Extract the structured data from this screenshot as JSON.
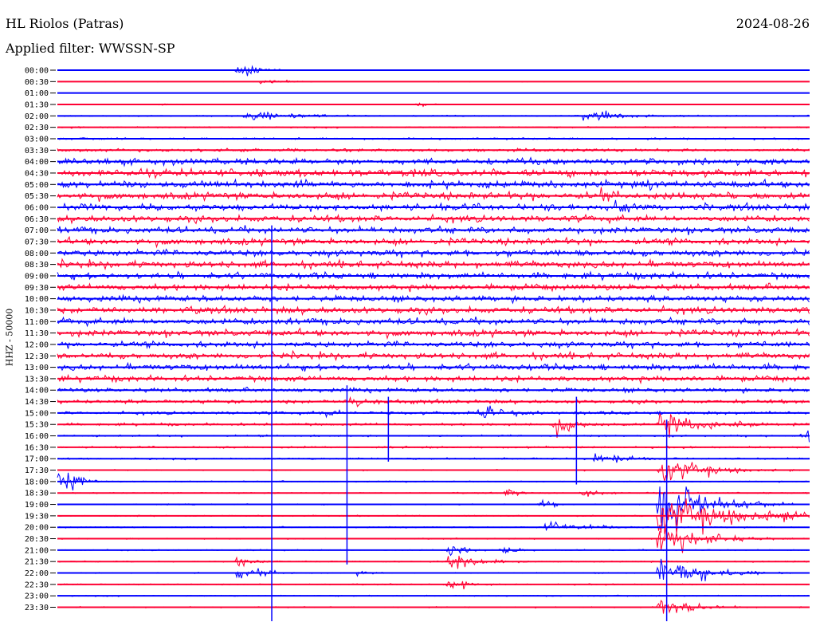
{
  "header": {
    "station": "HL Riolos (Patras)",
    "date": "2024-08-26",
    "filter": "Applied filter: WWSSN-SP"
  },
  "chart_data": {
    "type": "line",
    "title": "HL Riolos (Patras)",
    "subtitle": "Applied filter: WWSSN-SP",
    "date": "2024-08-26",
    "ylabel": "HHZ - 50000",
    "row_labels": [
      "00:00",
      "00:30",
      "01:00",
      "01:30",
      "02:00",
      "02:30",
      "03:00",
      "03:30",
      "04:00",
      "04:30",
      "05:00",
      "05:30",
      "06:00",
      "06:30",
      "07:00",
      "07:30",
      "08:00",
      "08:30",
      "09:00",
      "09:30",
      "10:00",
      "10:30",
      "11:00",
      "11:30",
      "12:00",
      "12:30",
      "13:00",
      "13:30",
      "14:00",
      "14:30",
      "15:00",
      "15:30",
      "16:00",
      "16:30",
      "17:00",
      "17:30",
      "18:00",
      "18:30",
      "19:00",
      "19:30",
      "20:00",
      "20:30",
      "21:00",
      "21:30",
      "22:00",
      "22:30",
      "23:00",
      "23:30"
    ],
    "row_colors": [
      "#0000ff",
      "#ff0033"
    ],
    "noise_level": [
      0.3,
      0.4,
      0.2,
      0.4,
      1.0,
      1.2,
      1.5,
      2.5,
      5,
      6,
      6,
      6,
      5.5,
      5.5,
      5.5,
      5.5,
      5.5,
      5.5,
      5,
      5,
      5,
      5.5,
      5.5,
      5.5,
      5,
      5,
      5,
      4.5,
      3.5,
      3,
      2.5,
      2,
      1.5,
      1.5,
      1.5,
      1,
      1,
      1,
      1,
      1,
      1,
      1,
      1,
      1,
      1,
      1,
      1,
      1
    ],
    "events": [
      {
        "row": 0,
        "x": 0.24,
        "amp": 22,
        "dur": 0.02
      },
      {
        "row": 1,
        "x": 0.27,
        "amp": 6,
        "dur": 0.03
      },
      {
        "row": 3,
        "x": 0.135,
        "amp": 4,
        "dur": 0.02
      },
      {
        "row": 3,
        "x": 0.48,
        "amp": 6,
        "dur": 0.02
      },
      {
        "row": 4,
        "x": 0.25,
        "amp": 12,
        "dur": 0.07
      },
      {
        "row": 4,
        "x": 0.7,
        "amp": 10,
        "dur": 0.07
      },
      {
        "row": 10,
        "x": 0.78,
        "amp": 14,
        "dur": 0.03
      },
      {
        "row": 11,
        "x": 0.72,
        "amp": 14,
        "dur": 0.05
      },
      {
        "row": 12,
        "x": 0.74,
        "amp": 14,
        "dur": 0.05
      },
      {
        "row": 29,
        "x": 0.39,
        "amp": 14,
        "dur": 0.03
      },
      {
        "row": 30,
        "x": 0.35,
        "amp": 16,
        "dur": 0.02
      },
      {
        "row": 30,
        "x": 0.56,
        "amp": 14,
        "dur": 0.05
      },
      {
        "row": 31,
        "x": 0.66,
        "amp": 18,
        "dur": 0.04
      },
      {
        "row": 31,
        "x": 0.8,
        "amp": 30,
        "dur": 0.06
      },
      {
        "row": 32,
        "x": 0.99,
        "amp": 16,
        "dur": 0.03
      },
      {
        "row": 34,
        "x": 0.71,
        "amp": 12,
        "dur": 0.05
      },
      {
        "row": 35,
        "x": 0.8,
        "amp": 30,
        "dur": 0.06
      },
      {
        "row": 36,
        "x": 0.0,
        "amp": 40,
        "dur": 0.02
      },
      {
        "row": 37,
        "x": 0.595,
        "amp": 12,
        "dur": 0.02
      },
      {
        "row": 37,
        "x": 0.695,
        "amp": 10,
        "dur": 0.03
      },
      {
        "row": 38,
        "x": 0.8,
        "amp": 55,
        "dur": 0.06
      },
      {
        "row": 38,
        "x": 0.64,
        "amp": 12,
        "dur": 0.02
      },
      {
        "row": 39,
        "x": 0.8,
        "amp": 45,
        "dur": 0.1
      },
      {
        "row": 40,
        "x": 0.65,
        "amp": 12,
        "dur": 0.06
      },
      {
        "row": 41,
        "x": 0.8,
        "amp": 30,
        "dur": 0.06
      },
      {
        "row": 42,
        "x": 0.52,
        "amp": 20,
        "dur": 0.02
      },
      {
        "row": 42,
        "x": 0.59,
        "amp": 8,
        "dur": 0.03
      },
      {
        "row": 43,
        "x": 0.24,
        "amp": 10,
        "dur": 0.03
      },
      {
        "row": 43,
        "x": 0.52,
        "amp": 22,
        "dur": 0.04
      },
      {
        "row": 44,
        "x": 0.24,
        "amp": 14,
        "dur": 0.04
      },
      {
        "row": 44,
        "x": 0.4,
        "amp": 6,
        "dur": 0.03
      },
      {
        "row": 44,
        "x": 0.8,
        "amp": 30,
        "dur": 0.06
      },
      {
        "row": 45,
        "x": 0.52,
        "amp": 14,
        "dur": 0.03
      },
      {
        "row": 47,
        "x": 0.8,
        "amp": 20,
        "dur": 0.05
      }
    ],
    "vertical_spikes": [
      {
        "x": 0.285,
        "from_row": 14,
        "to_row": 47
      },
      {
        "x": 0.385,
        "from_row": 28,
        "to_row": 42
      },
      {
        "x": 0.44,
        "from_row": 29,
        "to_row": 33
      },
      {
        "x": 0.69,
        "from_row": 29,
        "to_row": 35
      },
      {
        "x": 0.81,
        "from_row": 31,
        "to_row": 47
      }
    ]
  }
}
